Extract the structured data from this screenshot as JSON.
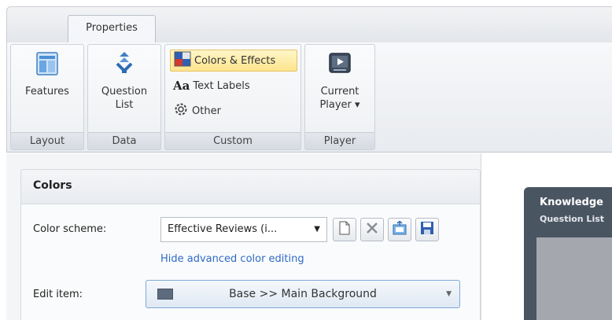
{
  "ribbon": {
    "tab": "Properties",
    "groups": {
      "layout": {
        "label": "Layout",
        "features_label": "Features"
      },
      "data": {
        "label": "Data",
        "question_list_line1": "Question",
        "question_list_line2": "List"
      },
      "custom": {
        "label": "Custom",
        "colors_effects": "Colors & Effects",
        "text_labels": "Text Labels",
        "other": "Other"
      },
      "player": {
        "label": "Player",
        "current_player_line1": "Current",
        "current_player_line2": "Player ▾"
      }
    }
  },
  "colors_panel": {
    "title": "Colors",
    "color_scheme_label": "Color scheme:",
    "color_scheme_value": "Effective Reviews (i...",
    "hide_advanced_link": "Hide advanced color editing",
    "edit_item_label": "Edit item:",
    "edit_item_value": "Base >> Main Background"
  },
  "preview": {
    "title": "Knowledge",
    "subtitle": "Question List"
  },
  "colors": {
    "accent_link": "#2f6bc6",
    "active_button": "#fde48d",
    "player_bg": "#4a5562"
  },
  "icons": [
    "features-icon",
    "question-list-icon",
    "colors-effects-icon",
    "text-labels-icon",
    "gear-icon",
    "player-icon",
    "new-document-icon",
    "delete-icon",
    "import-icon",
    "save-icon"
  ]
}
